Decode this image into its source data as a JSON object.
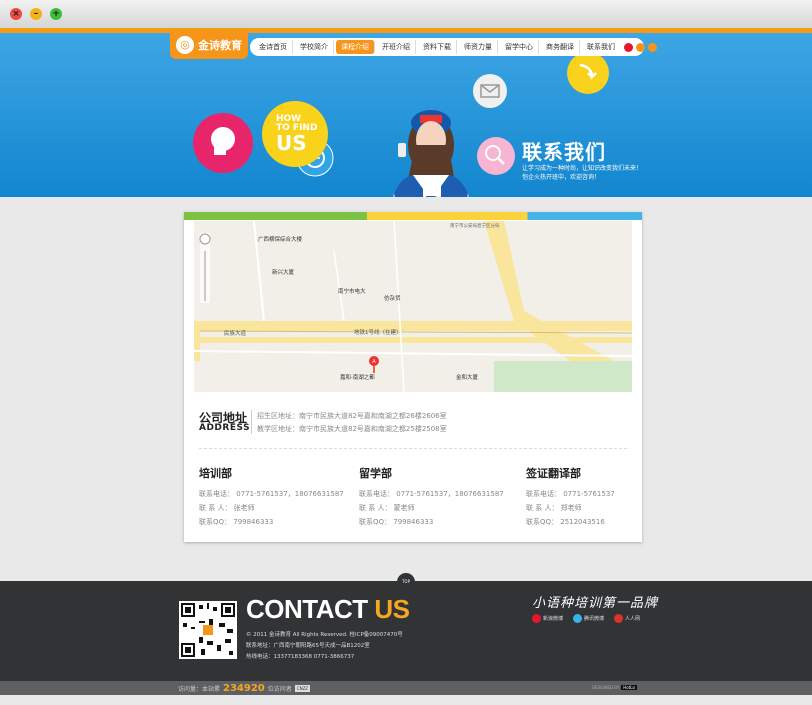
{
  "nav": {
    "logo_text": "金诗教育",
    "items": [
      "金诗首页",
      "学校简介",
      "课程介绍",
      "开班介绍",
      "资料下载",
      "师资力量",
      "留学中心",
      "商务翻译",
      "联系我们"
    ],
    "active_index": 2
  },
  "hero": {
    "how_small": "HOW\nTO FIND",
    "how_big": "US",
    "title": "联系我们",
    "line1": "让学习成为一种时尚，让知识改变我们未来！",
    "line2": "恺企火热开班中，欢迎咨询！"
  },
  "map_labels": {
    "road1": "民族大道",
    "road2": "地铁1号线（在建）",
    "place1": "广西横保综合大楼",
    "place2": "新兴大厦",
    "place3": "南宁市电大",
    "place4": "嘉和·南湖之都",
    "place5": "金和大厦",
    "place6": "仿杂货",
    "place7": "南宁市公安局邕宁区分局"
  },
  "address": {
    "title": "公司地址",
    "title_en": "ADDRESS",
    "line1": "招生区地址：南宁市民族大道82号嘉和南湖之都26楼2606室",
    "line2": "教学区地址：南宁市民族大道82号嘉和南湖之都25楼2508室"
  },
  "depts": [
    {
      "name": "培训部",
      "phone": "联系电话： 0771-5761537，18076631587",
      "person": "联  系  人： 张老师",
      "qq": "联系QQ： 799846333"
    },
    {
      "name": "留学部",
      "phone": "联系电话： 0771-5761537，18076631587",
      "person": "联  系  人： 蒙老师",
      "qq": "联系QQ： 799846333"
    },
    {
      "name": "签证翻译部",
      "phone": "联系电话： 0771-5761537",
      "person": "联  系  人： 郑老师",
      "qq": "联系QQ： 2512043516"
    }
  ],
  "footer": {
    "top": "TOP",
    "contact_a": "CONTACT",
    "contact_b": "US",
    "copyright": "© 2011 金诗教育 All Rights Reserved. 桂ICP备09007470号",
    "address": "联系地址：广西南宁朝阳路65号天成一品B1202室",
    "hotline": "热线电话：13377183368  0771-3866737",
    "slogan": "小语种培训第一品牌",
    "brand1": "新浪微博",
    "brand2": "腾讯微博",
    "brand3": "人人网",
    "visits_label": "访问量：本站累",
    "visits_num": "234920",
    "visits_suffix": "位访问者",
    "counter_badge": "CNZZ",
    "powered": "DESIGNED BY",
    "powered_brand": "HotLo"
  },
  "colors": {
    "orange": "#f6951a",
    "blue": "#1286cf",
    "dark": "#313335"
  }
}
